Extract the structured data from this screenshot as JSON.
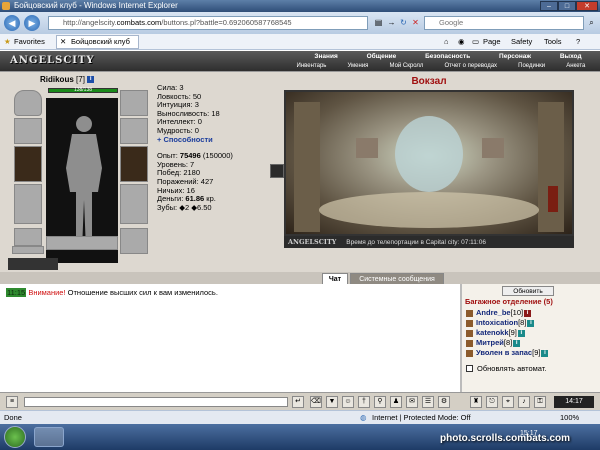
{
  "browser": {
    "title": "Бойцовский клуб - Windows Internet Explorer",
    "url_prefix": "http://angelscity.",
    "url_domain": "combats.com",
    "url_path": "/buttons.pl?battle=0.692060587768545",
    "search_placeholder": "Google",
    "favorites_label": "Favorites",
    "tab_title": "Бойцовский клуб",
    "cmd_page": "Page",
    "cmd_safety": "Safety",
    "cmd_tools": "Tools"
  },
  "game_menu": {
    "logo": "ANGELSCITY",
    "top": [
      "Знания",
      "Общение",
      "Безопасность",
      "Персонаж",
      "Выход"
    ],
    "bottom": [
      "Инвентарь",
      "Умения",
      "Мой Скролл",
      "Отчет о переводах",
      "Поединки",
      "Анкета"
    ]
  },
  "character": {
    "name": "Ridikous",
    "level": "[7]",
    "hp": "138/138",
    "stats": [
      "Сила: 3",
      "Ловкость: 50",
      "Интуиция: 3",
      "Выносливость: 18",
      "Интеллект: 0",
      "Мудрость: 0"
    ],
    "abilities_link": "+ Способности",
    "exp_label": "Опыт:",
    "exp_value": "75496",
    "exp_next": "(150000)",
    "level_line": "Уровень: 7",
    "wins": "Побед: 2180",
    "losses": "Поражений: 427",
    "draws": "Ничьих: 16",
    "money_label": "Деньги:",
    "money_value": "61.86",
    "money_unit": "кр.",
    "teeth": "Зубы: ◆2 ◆6.50"
  },
  "location": {
    "title": "Вокзал",
    "footer_logo": "ANGELSCITY",
    "footer_text": "Время до телепортации в Capital city: 07:11:06"
  },
  "chat": {
    "tab_chat": "Чат",
    "tab_system": "Системные сообщения",
    "message_time": "11:15",
    "message_warn": "Внимание!",
    "message_text": "Отношение высших сил к вам изменилось."
  },
  "sidebar": {
    "refresh_button": "Обновить",
    "bag_title": "Багажное отделение (5)",
    "users": [
      {
        "name": "Andre_be",
        "level": "[10]"
      },
      {
        "name": "Intoxication",
        "level": "[8]"
      },
      {
        "name": "katenokk",
        "level": "[9]"
      },
      {
        "name": "Митрей",
        "level": "[8]"
      },
      {
        "name": "Уволен в запас",
        "level": "[9]"
      }
    ],
    "auto_refresh_label": "Обновлять автомат."
  },
  "toolbar": {
    "clock": "14:17"
  },
  "status": {
    "left": "Done",
    "zone": "Internet | Protected Mode: Off",
    "zoom": "100%"
  },
  "taskbar": {
    "time": "15:17"
  },
  "watermark": "photo.scrolls.combats.com",
  "colors": {
    "accent_red": "#a01010",
    "link_blue": "#13287a",
    "hp_green": "#1a8a1a"
  }
}
